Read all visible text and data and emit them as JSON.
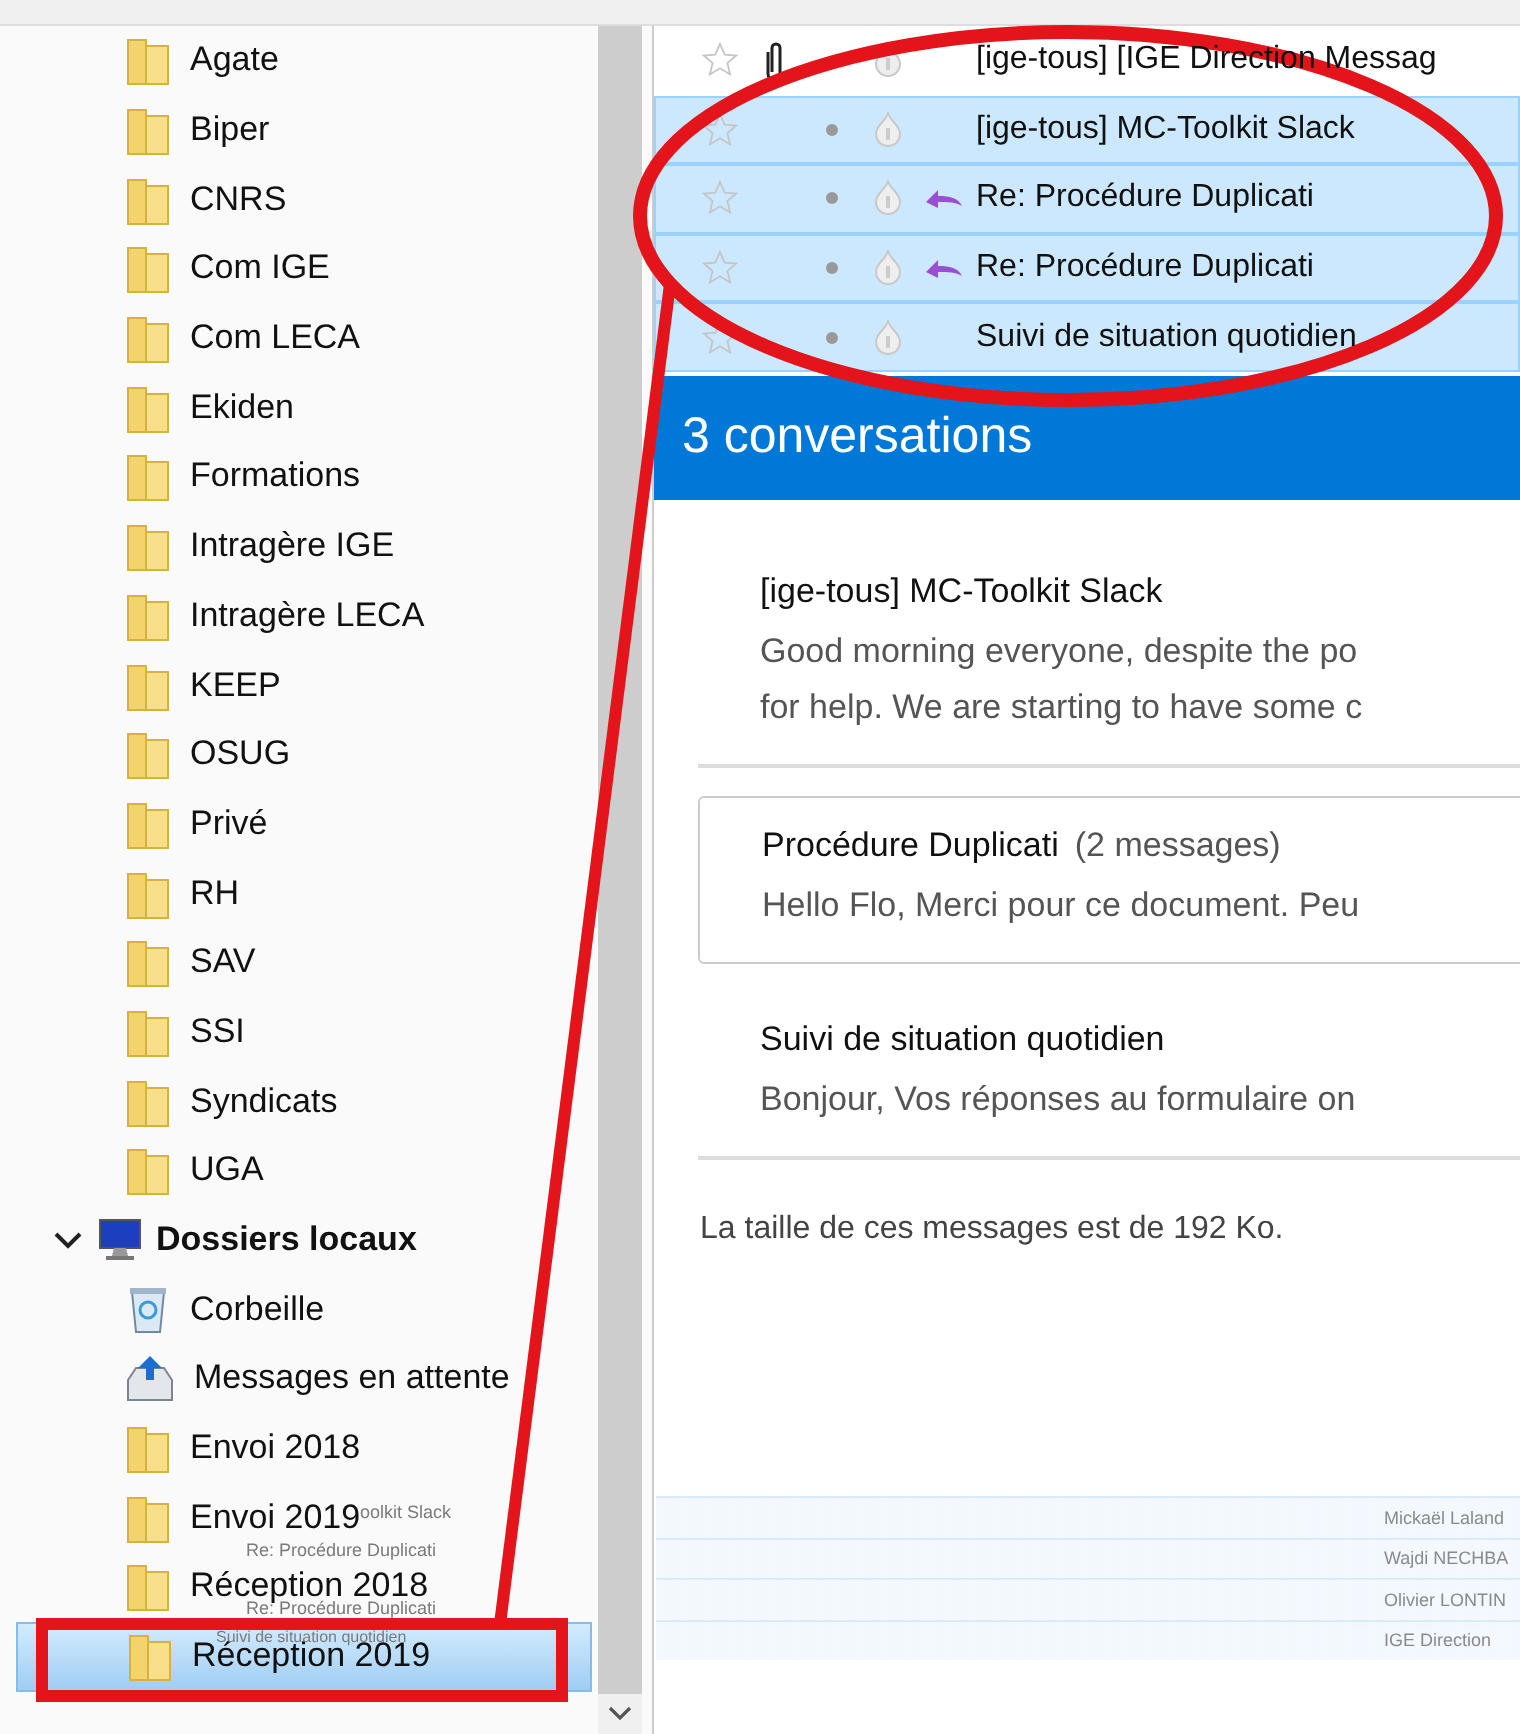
{
  "folders": [
    {
      "name": "Agate",
      "kind": "folder",
      "selected": false
    },
    {
      "name": "Biper",
      "kind": "folder",
      "selected": false
    },
    {
      "name": "CNRS",
      "kind": "folder",
      "selected": false
    },
    {
      "name": "Com IGE",
      "kind": "folder",
      "selected": false
    },
    {
      "name": "Com LECA",
      "kind": "folder",
      "selected": false
    },
    {
      "name": "Ekiden",
      "kind": "folder",
      "selected": false
    },
    {
      "name": "Formations",
      "kind": "folder",
      "selected": false
    },
    {
      "name": "Intragère IGE",
      "kind": "folder",
      "selected": false
    },
    {
      "name": "Intragère LECA",
      "kind": "folder",
      "selected": false
    },
    {
      "name": "KEEP",
      "kind": "folder",
      "selected": false
    },
    {
      "name": "OSUG",
      "kind": "folder",
      "selected": false
    },
    {
      "name": "Privé",
      "kind": "folder",
      "selected": false
    },
    {
      "name": "RH",
      "kind": "folder",
      "selected": false
    },
    {
      "name": "SAV",
      "kind": "folder",
      "selected": false
    },
    {
      "name": "SSI",
      "kind": "folder",
      "selected": false
    },
    {
      "name": "Syndicats",
      "kind": "folder",
      "selected": false
    },
    {
      "name": "UGA",
      "kind": "folder",
      "selected": false
    }
  ],
  "local_folders": {
    "name": "Dossiers locaux",
    "expanded": true,
    "children": [
      {
        "name": "Corbeille",
        "kind": "trash",
        "selected": false
      },
      {
        "name": "Messages en attente",
        "kind": "outbox",
        "selected": false
      },
      {
        "name": "Envoi 2018",
        "kind": "folder",
        "selected": false
      },
      {
        "name": "Envoi 2019",
        "kind": "folder",
        "selected": false
      },
      {
        "name": "Réception 2018",
        "kind": "folder",
        "selected": false
      },
      {
        "name": "Réception 2019",
        "kind": "folder",
        "selected": true
      }
    ]
  },
  "messages": [
    {
      "subject": "[ige-tous] [IGE Direction Messag",
      "attachment": true,
      "read": false,
      "replied": false,
      "selected": false
    },
    {
      "subject": "[ige-tous] MC-Toolkit Slack",
      "attachment": false,
      "read": true,
      "replied": false,
      "selected": true
    },
    {
      "subject": "Re: Procédure Duplicati",
      "attachment": false,
      "read": true,
      "replied": true,
      "selected": true
    },
    {
      "subject": "Re: Procédure Duplicati",
      "attachment": false,
      "read": true,
      "replied": true,
      "selected": true
    },
    {
      "subject": "Suivi de situation quotidien",
      "attachment": false,
      "read": true,
      "replied": false,
      "selected": true
    }
  ],
  "summary": {
    "heading": "3 conversations",
    "conversations": [
      {
        "title": "[ige-tous] MC-Toolkit Slack",
        "snippet": [
          "Good morning everyone, despite the po",
          "for help. We are starting to have some c"
        ],
        "highlighted": false
      },
      {
        "title": "Procédure Duplicati",
        "count": "(2 messages)",
        "snippet": [
          "Hello Flo, Merci pour ce document. Peu"
        ],
        "highlighted": true
      },
      {
        "title": "Suivi de situation quotidien",
        "snippet": [
          "Bonjour, Vos réponses au formulaire on"
        ],
        "highlighted": false
      }
    ],
    "footer": "La taille de ces messages est de 192 Ko."
  },
  "drag_ghost": [
    {
      "subject": "oolkit Slack",
      "sender": "Mickaël Laland"
    },
    {
      "subject": "Re: Procédure Duplicati",
      "sender": "Wajdi NECHBA"
    },
    {
      "subject": "Re: Procédure Duplicati",
      "sender": "Olivier LONTIN"
    },
    {
      "subject": "Suivi de situation quotidien",
      "sender": "IGE Direction"
    }
  ]
}
